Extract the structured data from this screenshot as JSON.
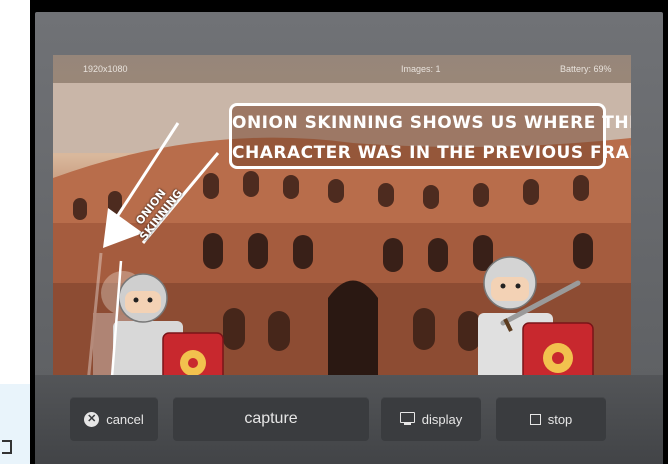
{
  "status_bar": {
    "resolution": "1920x1080",
    "images": "Images: 1",
    "battery": "Battery: 69%"
  },
  "overlay": {
    "callout_line1": "ONION SKINNING SHOWS US WHERE THE",
    "callout_line2": "CHARACTER WAS IN THE PREVIOUS FRAME",
    "arrow_label_line1": "ONION",
    "arrow_label_line2": "SKINNING"
  },
  "toolbar": {
    "cancel_label": "cancel",
    "capture_label": "capture",
    "display_label": "display",
    "stop_label": "stop"
  },
  "icons": {
    "cancel": "x-circle-icon",
    "display": "monitor-icon",
    "stop": "square-icon"
  },
  "colors": {
    "toolbar_bg": "#4a4c4f",
    "button_bg": "#3a3c3f",
    "roman_red": "#c8282e",
    "shield_gold": "#f2c14e"
  }
}
